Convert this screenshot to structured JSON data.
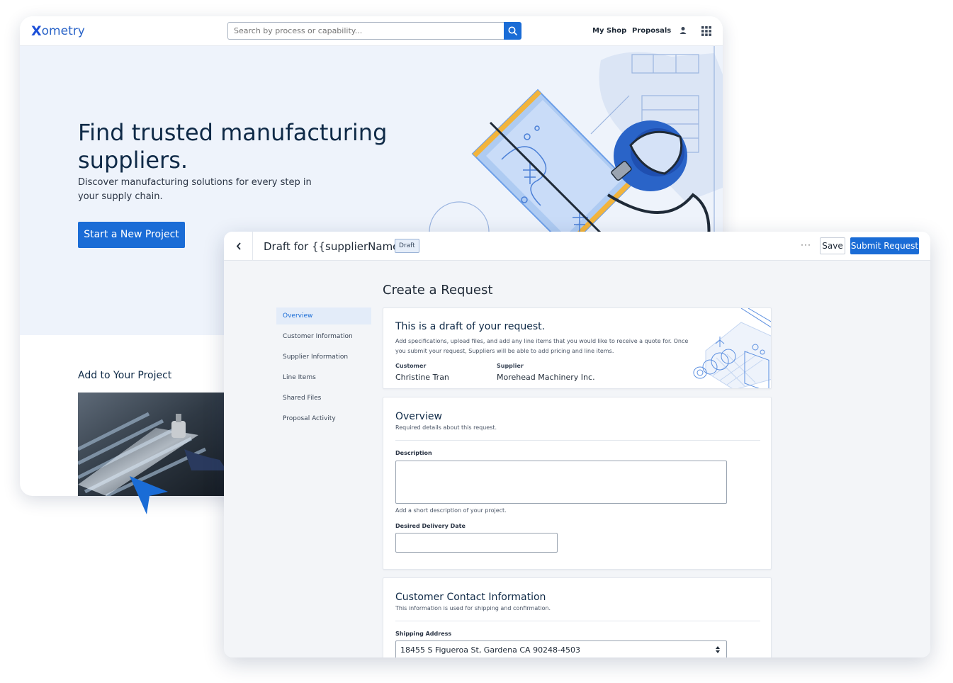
{
  "site": {
    "logo": "Xometry",
    "logo_x": "X",
    "logo_rest": "ometry",
    "search": {
      "placeholder": "Search by process or capability..."
    },
    "nav": {
      "my_shop": "My Shop",
      "proposals": "Proposals"
    },
    "hero": {
      "title": "Find trusted manufacturing suppliers.",
      "subtitle": "Discover manufacturing solutions for every step in your supply chain.",
      "cta": "Start a New Project"
    },
    "add_section_title": "Add to Your Project"
  },
  "request": {
    "header": {
      "title": "Draft for {{supplierName}}",
      "badge": "Draft",
      "more": "···",
      "save": "Save",
      "submit": "Submit Request"
    },
    "page_heading": "Create a Request",
    "side_nav": [
      {
        "label": "Overview",
        "active": true
      },
      {
        "label": "Customer Information",
        "active": false
      },
      {
        "label": "Supplier Information",
        "active": false
      },
      {
        "label": "Line Items",
        "active": false
      },
      {
        "label": "Shared Files",
        "active": false
      },
      {
        "label": "Proposal Activity",
        "active": false
      }
    ],
    "draft_card": {
      "title": "This is a draft of your request.",
      "description": "Add specifications, upload files, and add any line items that you would like to receive a quote for. Once you submit your request, Suppliers will be able to add pricing and line items.",
      "customer_label": "Customer",
      "customer_value": "Christine Tran",
      "supplier_label": "Supplier",
      "supplier_value": "Morehead Machinery Inc."
    },
    "overview_card": {
      "title": "Overview",
      "subtitle": "Required details about this request.",
      "description_label": "Description",
      "description_value": "",
      "description_help": "Add a short description of your project.",
      "date_label": "Desired Delivery Date",
      "date_value": ""
    },
    "contact_card": {
      "title": "Customer Contact Information",
      "subtitle": "This information is used for shipping and confirmation.",
      "shipping_label": "Shipping Address",
      "shipping_value": "18455 S Figueroa St, Gardena CA 90248-4503"
    }
  },
  "colors": {
    "primary": "#1a6cd6",
    "hero_bg": "#eef3fb",
    "heading": "#0f2a47"
  }
}
